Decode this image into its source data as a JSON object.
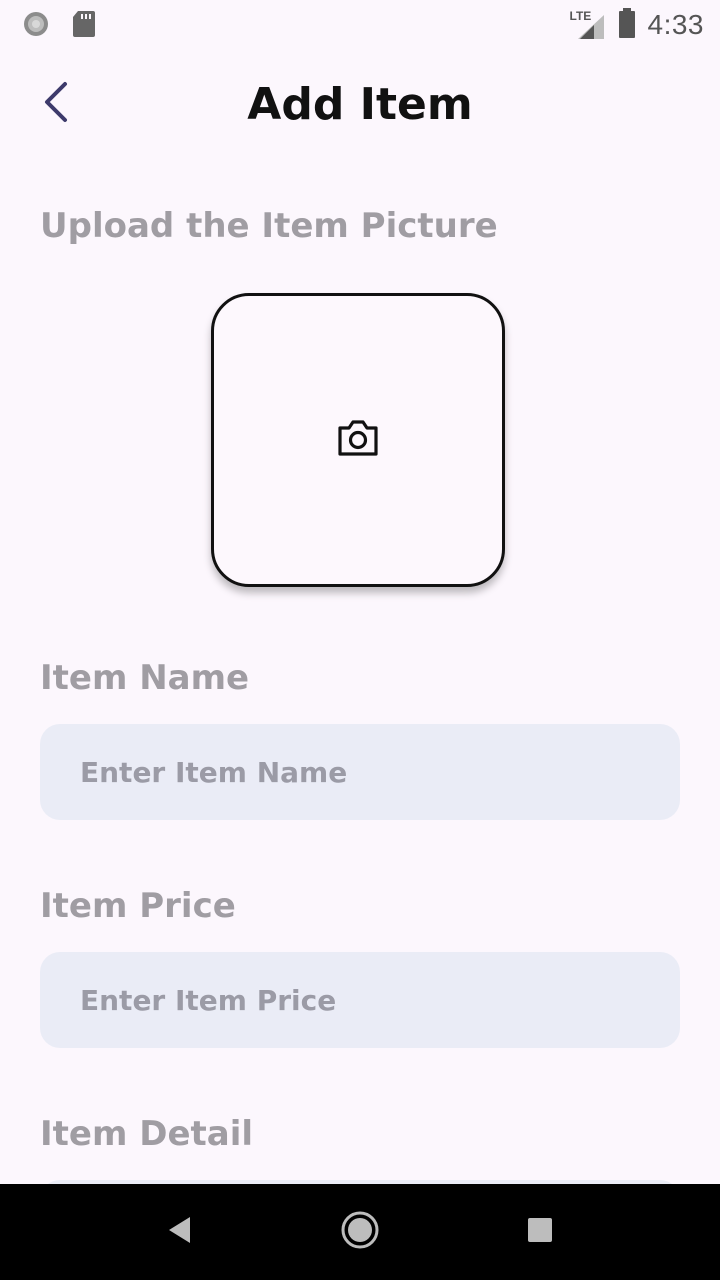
{
  "status_bar": {
    "time": "4:33",
    "network_label": "LTE",
    "icons": [
      "loading-icon",
      "sd-card-icon",
      "signal-icon",
      "battery-icon"
    ]
  },
  "header": {
    "title": "Add Item",
    "back_icon": "chevron-left-icon"
  },
  "form": {
    "upload_label": "Upload the Item Picture",
    "upload_icon": "camera-icon",
    "item_name": {
      "label": "Item Name",
      "placeholder": "Enter Item Name",
      "value": ""
    },
    "item_price": {
      "label": "Item Price",
      "placeholder": "Enter Item Price",
      "value": ""
    },
    "item_detail": {
      "label": "Item Detail"
    }
  },
  "colors": {
    "background": "#fcf7fd",
    "accent": "#3d3a6b",
    "label": "#a09da3",
    "input_bg": "#eaecf6"
  },
  "nav_bar": {
    "icons": [
      "back-triangle-icon",
      "home-circle-icon",
      "recents-square-icon"
    ]
  }
}
